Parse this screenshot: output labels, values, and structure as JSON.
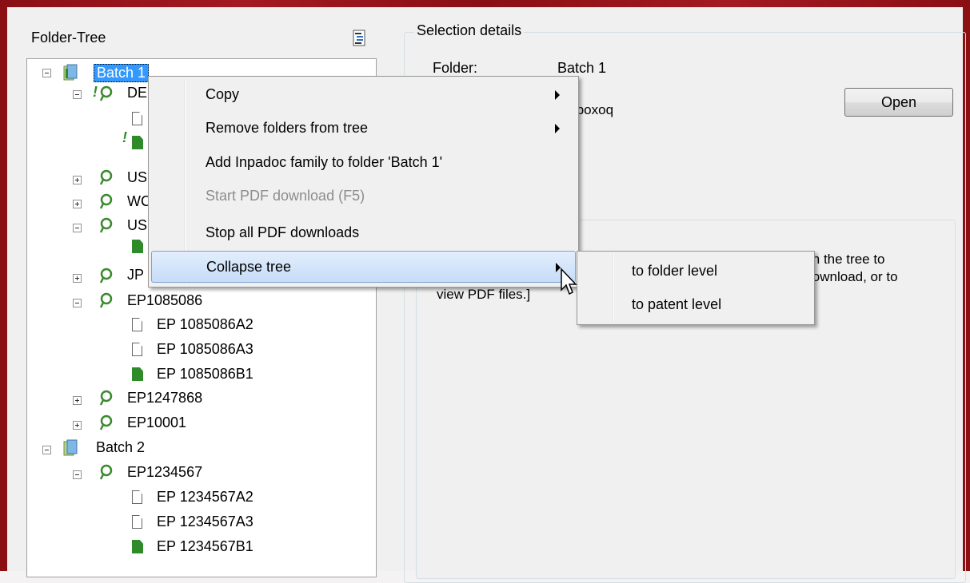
{
  "tree": {
    "title": "Folder-Tree",
    "nodes": [
      {
        "label": "Batch 1"
      },
      {
        "label": "DE"
      },
      {
        "label": "US"
      },
      {
        "label": "WC"
      },
      {
        "label": "US"
      },
      {
        "label": "JP"
      },
      {
        "label": "EP1085086"
      },
      {
        "label": "EP 1085086A2"
      },
      {
        "label": "EP 1085086A3"
      },
      {
        "label": "EP 1085086B1"
      },
      {
        "label": "EP1247868"
      },
      {
        "label": "EP10001"
      },
      {
        "label": "Batch 2"
      },
      {
        "label": "EP1234567"
      },
      {
        "label": "EP 1234567A2"
      },
      {
        "label": "EP 1234567A3"
      },
      {
        "label": "EP 1234567B1"
      }
    ]
  },
  "details": {
    "legend": "Selection details",
    "folder_label": "Folder:",
    "folder_value": "Batch 1",
    "second_value_fragment": "\\poxoq",
    "open_button": "Open",
    "hint_line1": "in the tree to",
    "hint_line2": "lownload, or to",
    "hint_line3": "view PDF files.]"
  },
  "context_menu": {
    "items": [
      {
        "label": "Copy"
      },
      {
        "label": "Remove folders from tree"
      },
      {
        "label": "Add Inpadoc family to folder 'Batch 1'"
      },
      {
        "label": "Start PDF download (F5)"
      },
      {
        "label": "Stop all PDF downloads"
      },
      {
        "label": "Collapse tree"
      }
    ],
    "submenu": [
      {
        "label": "to folder level"
      },
      {
        "label": "to patent level"
      }
    ]
  },
  "colors": {
    "frame": "#8c0f14",
    "selection": "#3399ff",
    "doc_green": "#2f8b2a",
    "lens_green": "#3a8a2e"
  }
}
